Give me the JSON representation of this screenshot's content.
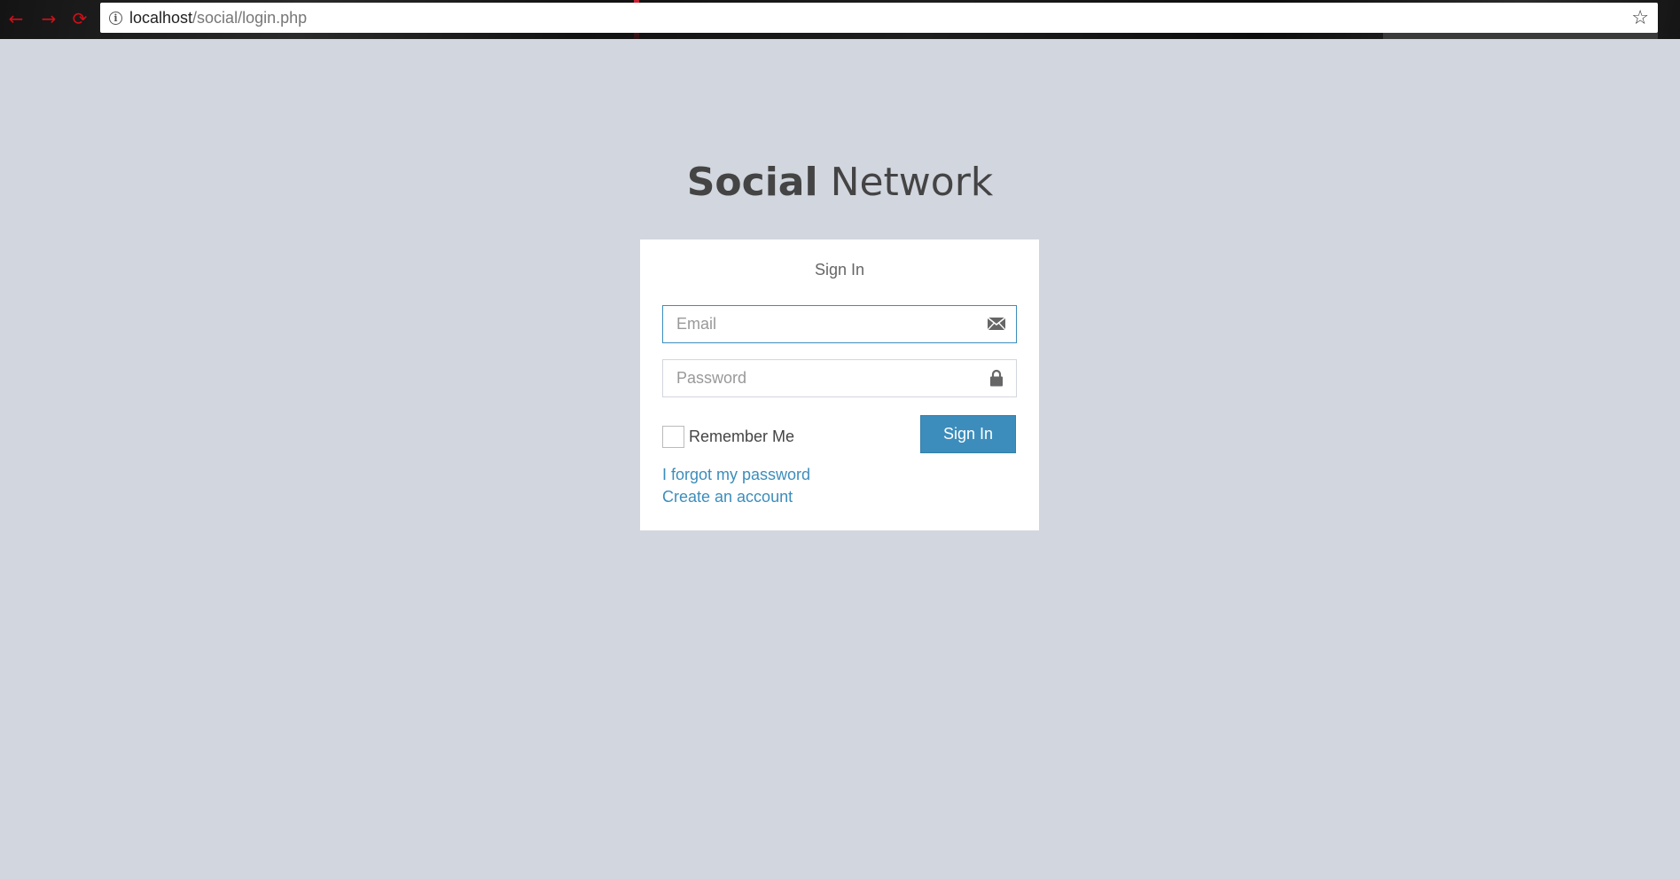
{
  "browser": {
    "url_host": "localhost",
    "url_path": "/social/login.php",
    "back_icon": "←",
    "forward_icon": "→",
    "reload_icon": "⟳",
    "info_icon": "i",
    "star_icon": "☆"
  },
  "logo": {
    "bold": "Social",
    "light": " Network"
  },
  "login": {
    "message": "Sign In",
    "email": {
      "value": "",
      "placeholder": "Email",
      "icon": "envelope-icon"
    },
    "password": {
      "value": "",
      "placeholder": "Password",
      "icon": "lock-icon"
    },
    "remember_label": "Remember Me",
    "remember_checked": false,
    "submit_label": "Sign In",
    "forgot_link": "I forgot my password",
    "register_link": "Create an account"
  },
  "colors": {
    "page_background": "#d2d6de",
    "primary": "#3c8dbc",
    "focus_border": "#3c8dbc",
    "nav_icons": "#d0101a"
  }
}
